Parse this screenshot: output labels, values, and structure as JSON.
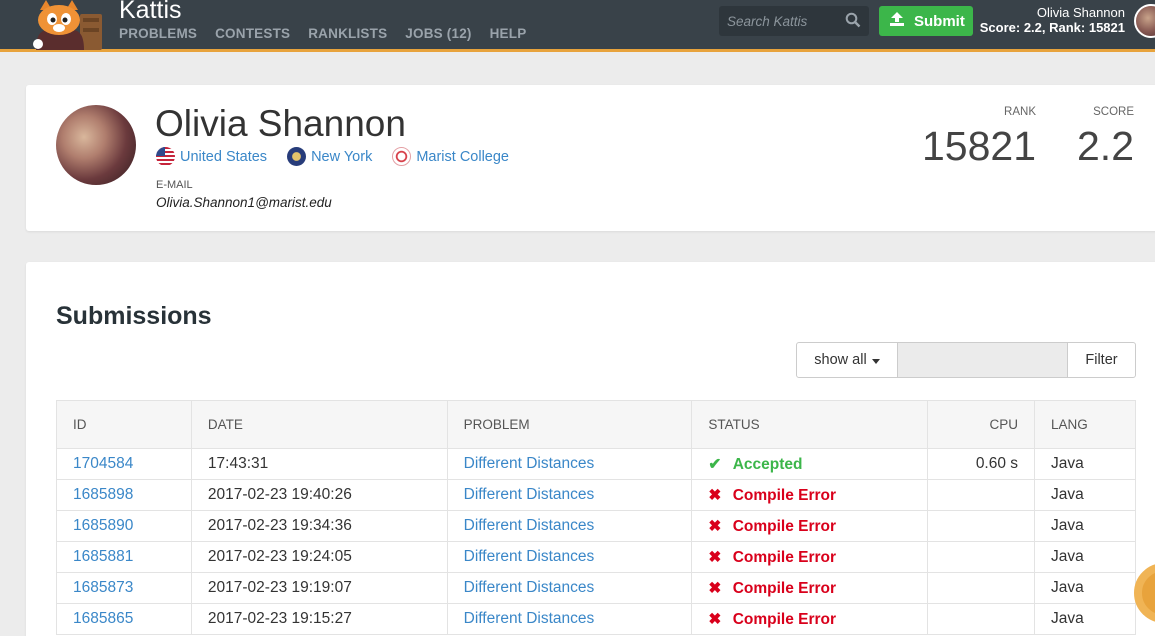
{
  "nav": {
    "brand": "Kattis",
    "links": [
      "PROBLEMS",
      "CONTESTS",
      "RANKLISTS",
      "JOBS (12)",
      "HELP"
    ],
    "search_placeholder": "Search Kattis",
    "submit_label": "Submit",
    "user_name": "Olivia Shannon",
    "user_score": "Score: 2.2, Rank: 15821"
  },
  "profile": {
    "name": "Olivia Shannon",
    "country": "United States",
    "region": "New York",
    "school": "Marist College",
    "email_label": "E-MAIL",
    "email": "Olivia.Shannon1@marist.edu",
    "rank_label": "RANK",
    "rank": "15821",
    "score_label": "SCORE",
    "score": "2.2"
  },
  "submissions": {
    "title": "Submissions",
    "filter_dropdown": "show all",
    "filter_button": "Filter",
    "columns": [
      "ID",
      "DATE",
      "PROBLEM",
      "STATUS",
      "CPU",
      "LANG"
    ],
    "rows": [
      {
        "id": "1704584",
        "date": "17:43:31",
        "problem": "Different Distances",
        "status": "Accepted",
        "cpu": "0.60 s",
        "lang": "Java"
      },
      {
        "id": "1685898",
        "date": "2017-02-23 19:40:26",
        "problem": "Different Distances",
        "status": "Compile Error",
        "cpu": "",
        "lang": "Java"
      },
      {
        "id": "1685890",
        "date": "2017-02-23 19:34:36",
        "problem": "Different Distances",
        "status": "Compile Error",
        "cpu": "",
        "lang": "Java"
      },
      {
        "id": "1685881",
        "date": "2017-02-23 19:24:05",
        "problem": "Different Distances",
        "status": "Compile Error",
        "cpu": "",
        "lang": "Java"
      },
      {
        "id": "1685873",
        "date": "2017-02-23 19:19:07",
        "problem": "Different Distances",
        "status": "Compile Error",
        "cpu": "",
        "lang": "Java"
      },
      {
        "id": "1685865",
        "date": "2017-02-23 19:15:27",
        "problem": "Different Distances",
        "status": "Compile Error",
        "cpu": "",
        "lang": "Java"
      }
    ]
  },
  "colors": {
    "nav_bg": "#394249",
    "accent": "#e8a33c",
    "link": "#3a87c8",
    "accepted": "#3cb64a",
    "error": "#d9001b"
  }
}
